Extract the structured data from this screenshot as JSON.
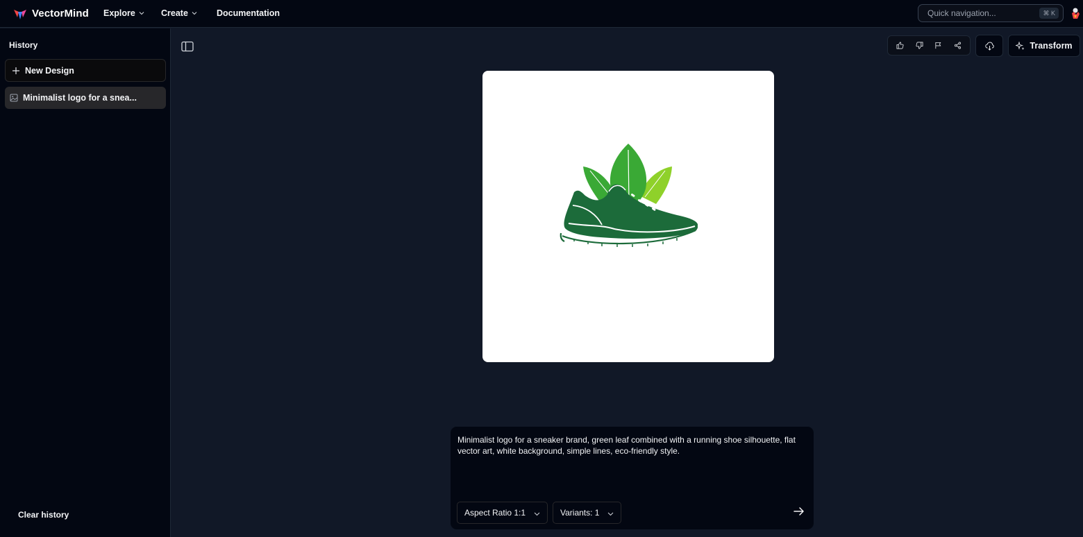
{
  "app": {
    "brand_name": "VectorMind",
    "brand_colors": [
      "#ef4444",
      "#3b82f6",
      "#ec4899"
    ]
  },
  "nav": {
    "explore": "Explore",
    "create": "Create",
    "documentation": "Documentation"
  },
  "search": {
    "placeholder": "Quick navigation...",
    "shortcut": "⌘ K"
  },
  "sidebar": {
    "title": "History",
    "new_design": "New Design",
    "history_items": [
      "Minimalist logo for a snea..."
    ],
    "clear": "Clear history"
  },
  "toolbar": {
    "icons": [
      "thumbs-up-icon",
      "thumbs-down-icon",
      "flag-icon",
      "share-icon",
      "download-icon"
    ],
    "transform_label": "Transform"
  },
  "canvas": {
    "image_alt": "green leaf and running shoe logo",
    "leaf_colors": [
      "#3aa935",
      "#8fd12a"
    ],
    "shoe_color": "#1c6b3a"
  },
  "prompt": {
    "text": "Minimalist logo for a sneaker brand, green leaf combined with a running shoe silhouette, flat vector art, white background, simple lines, eco-friendly style.",
    "aspect_ratio_label": "Aspect Ratio 1:1",
    "variants_label": "Variants: 1"
  }
}
